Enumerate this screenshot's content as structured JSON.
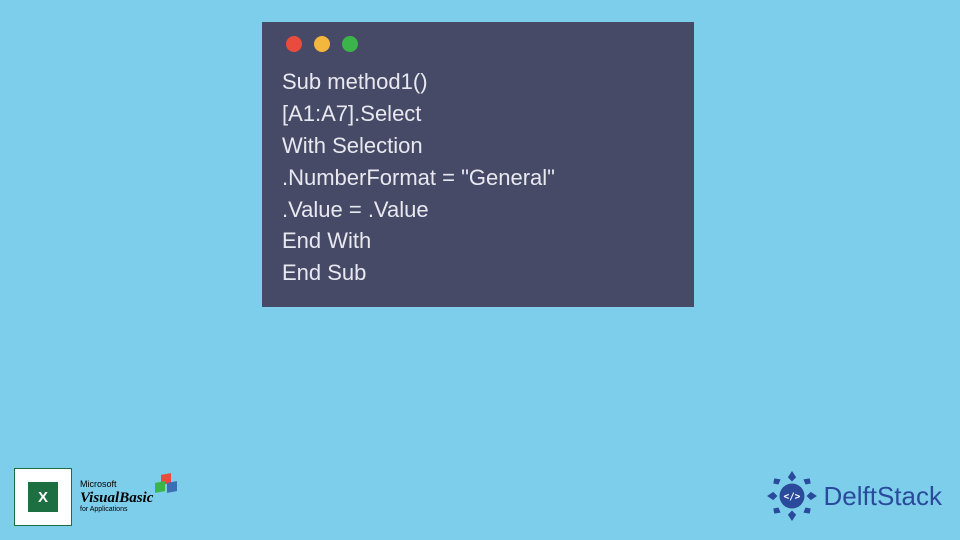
{
  "code": {
    "lines": [
      "Sub method1()",
      "[A1:A7].Select",
      "With Selection",
      ".NumberFormat = \"General\"",
      ".Value = .Value",
      "End With",
      "End Sub"
    ]
  },
  "icons": {
    "excel_letter": "X",
    "vb_ms": "Microsoft",
    "vb_main": "VisualBasic",
    "vb_sub": "for Applications"
  },
  "brand": {
    "name": "DelftStack"
  },
  "colors": {
    "bg": "#7dceeb",
    "window": "#474a66",
    "text": "#e8e8f0",
    "brand": "#2a4b9b"
  }
}
